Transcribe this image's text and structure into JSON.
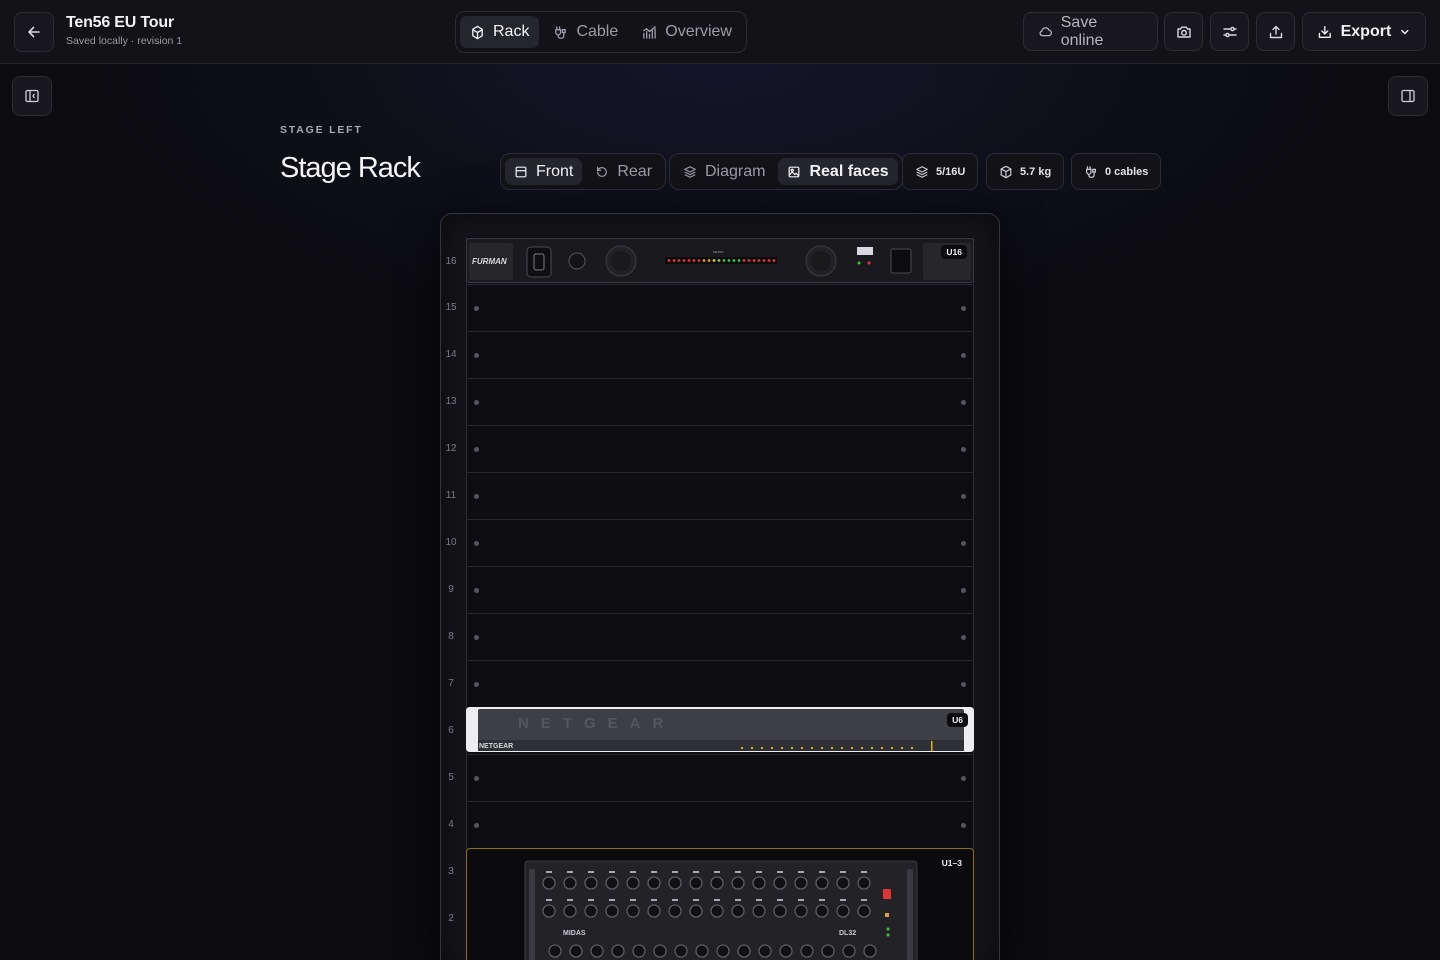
{
  "header": {
    "title": "Ten56 EU Tour",
    "subtitle": "Saved locally · revision 1",
    "tabs": [
      {
        "label": "Rack",
        "icon": "rack-icon",
        "active": true
      },
      {
        "label": "Cable",
        "icon": "cable-icon",
        "active": false
      },
      {
        "label": "Overview",
        "icon": "chart-icon",
        "active": false
      }
    ],
    "save_online": "Save online",
    "export": "Export"
  },
  "rack": {
    "location": "STAGE LEFT",
    "name": "Stage Rack",
    "view_tabs": [
      {
        "label": "Front",
        "active": true
      },
      {
        "label": "Rear",
        "active": false
      }
    ],
    "face_tabs": [
      {
        "label": "Diagram",
        "active": false
      },
      {
        "label": "Real faces",
        "active": true
      }
    ],
    "stats": {
      "units": "5/16U",
      "weight": "5.7 kg",
      "cables": "0 cables"
    },
    "unit_numbers": [
      "16",
      "15",
      "14",
      "13",
      "12",
      "11",
      "10",
      "9",
      "8",
      "7",
      "6",
      "5",
      "4",
      "3",
      "2"
    ],
    "devices": [
      {
        "badge": "U16",
        "brand": "FURMAN",
        "label": "METER"
      },
      {
        "badge": "U6",
        "brand": "NETGEAR"
      },
      {
        "badge": "U1–3",
        "brand": "MIDAS",
        "model": "DL32"
      }
    ]
  },
  "colors": {
    "background": "#0b0b10",
    "topbar": "#121217",
    "border": "#2c2c35",
    "active_tab": "#25252d",
    "device_highlight": "#8a6d1d"
  }
}
